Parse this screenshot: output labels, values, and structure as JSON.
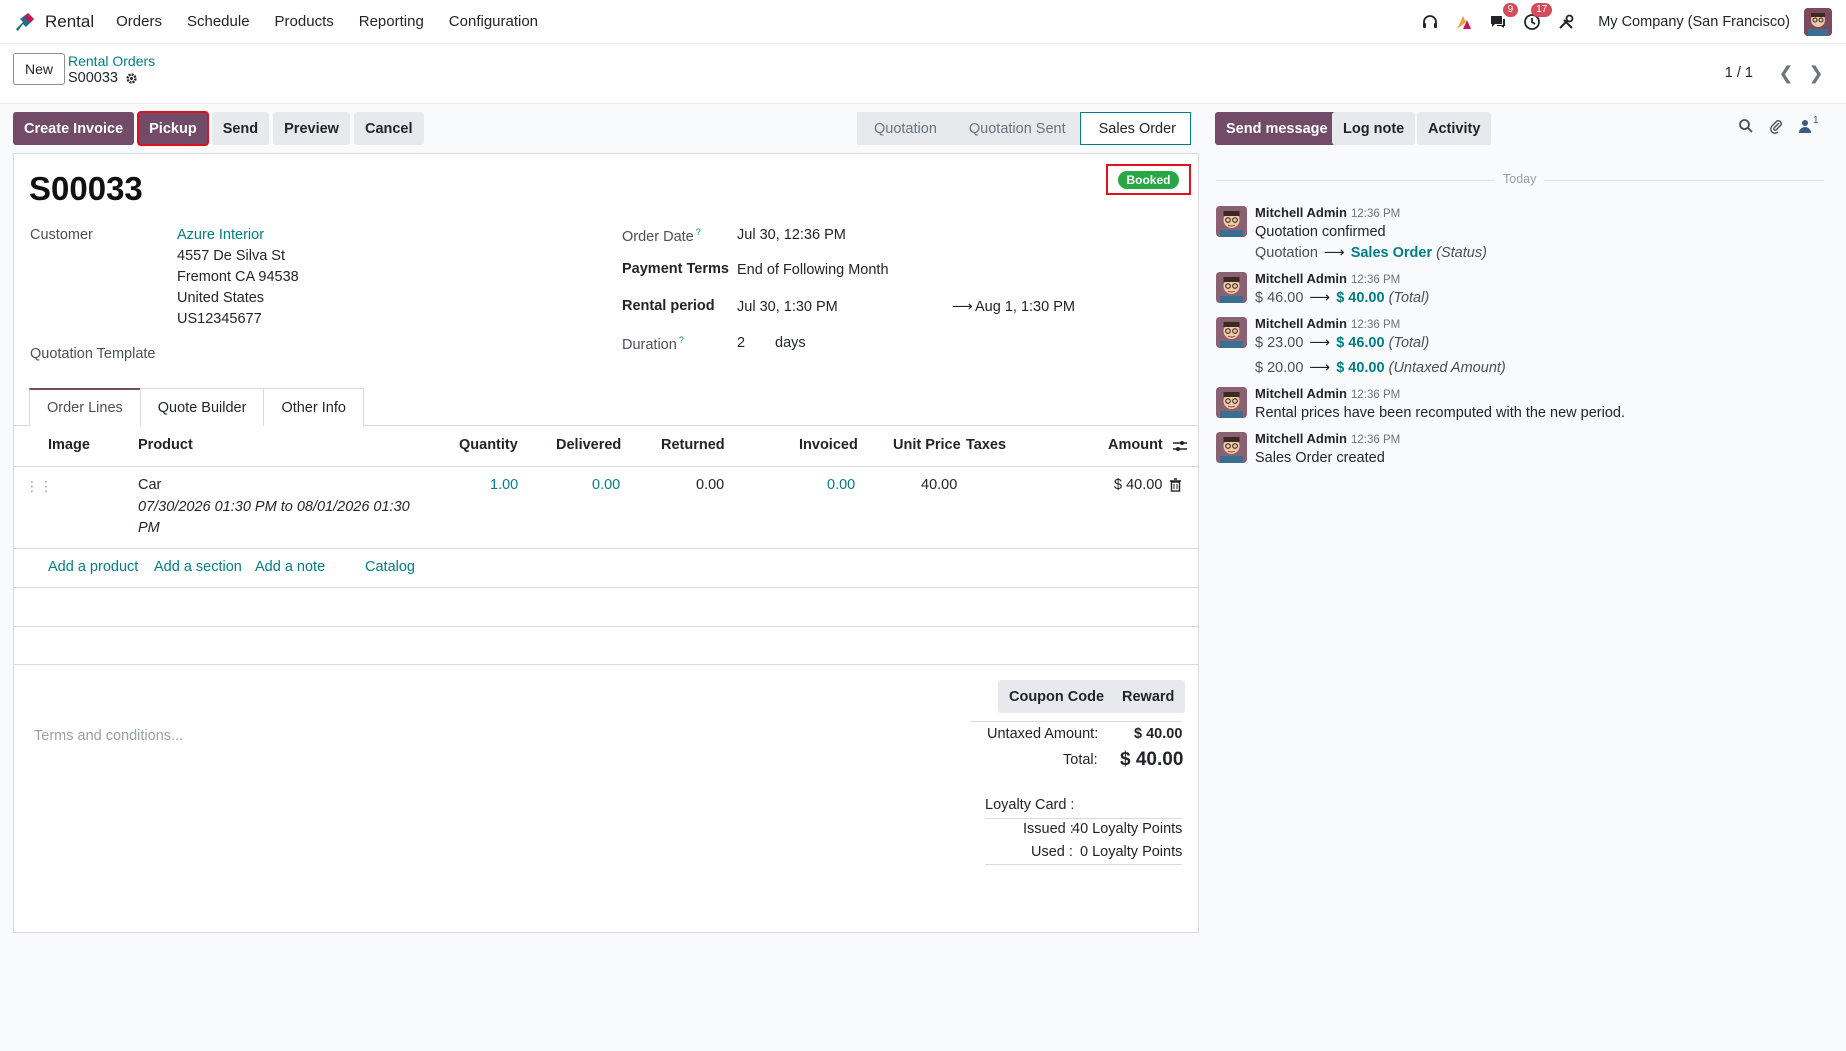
{
  "navbar": {
    "app_name": "Rental",
    "menu": [
      "Orders",
      "Schedule",
      "Products",
      "Reporting",
      "Configuration"
    ],
    "messages_count": "9",
    "activities_count": "17",
    "company": "My Company (San Francisco)"
  },
  "control": {
    "new_label": "New",
    "breadcrumb_parent": "Rental Orders",
    "breadcrumb_current": "S00033",
    "pager_value": "1 / 1"
  },
  "actions": {
    "create_invoice": "Create Invoice",
    "pickup": "Pickup",
    "send": "Send",
    "preview": "Preview",
    "cancel": "Cancel"
  },
  "stages": [
    "Quotation",
    "Quotation Sent",
    "Sales Order"
  ],
  "form": {
    "ribbon": "Booked",
    "title": "S00033",
    "customer_label": "Customer",
    "customer_name": "Azure Interior",
    "address": [
      "4557 De Silva St",
      "Fremont CA 94538",
      "United States",
      "US12345677"
    ],
    "quotation_template_label": "Quotation Template",
    "order_date_label": "Order Date",
    "order_date": "Jul 30, 12:36 PM",
    "payment_terms_label": "Payment Terms",
    "payment_terms": "End of Following Month",
    "rental_period_label": "Rental period",
    "rental_start": "Jul 30, 1:30 PM",
    "rental_end": "Aug 1, 1:30 PM",
    "duration_label": "Duration",
    "duration_value": "2",
    "duration_unit": "days",
    "help_mark": "?"
  },
  "tabs": [
    "Order Lines",
    "Quote Builder",
    "Other Info"
  ],
  "lines": {
    "headers": [
      "Image",
      "Product",
      "Quantity",
      "Delivered",
      "Returned",
      "Invoiced",
      "Unit Price",
      "Taxes",
      "Amount"
    ],
    "rows": [
      {
        "product": "Car",
        "description": "07/30/2026 01:30 PM to 08/01/2026 01:30",
        "description2": "PM",
        "quantity": "1.00",
        "delivered": "0.00",
        "returned": "0.00",
        "invoiced": "0.00",
        "unit_price": "40.00",
        "amount": "$ 40.00"
      }
    ],
    "add_links": [
      "Add a product",
      "Add a section",
      "Add a note",
      "Catalog"
    ]
  },
  "footer": {
    "coupon_label": "Coupon Code",
    "reward_label": "Reward",
    "terms_placeholder": "Terms and conditions...",
    "untaxed_label": "Untaxed Amount:",
    "untaxed_value": "$ 40.00",
    "total_label": "Total:",
    "total_value": "$ 40.00",
    "loyalty_label": "Loyalty Card :",
    "issued_label": "Issued :",
    "issued_value": "40 Loyalty Points",
    "used_label": "Used :",
    "used_value": "0 Loyalty Points"
  },
  "chatter": {
    "send_message": "Send message",
    "log_note": "Log note",
    "activity": "Activity",
    "followers_count": "1",
    "day_label": "Today",
    "messages": [
      {
        "author": "Mitchell Admin",
        "time": "12:36 PM",
        "text": "Quotation confirmed",
        "change_old": "Quotation",
        "change_new": "Sales Order",
        "change_field": "(Status)"
      },
      {
        "author": "Mitchell Admin",
        "time": "12:36 PM",
        "change_old": "$ 46.00",
        "change_new": "$ 40.00",
        "change_field": "(Total)"
      },
      {
        "author": "Mitchell Admin",
        "time": "12:36 PM",
        "change_old": "$ 23.00",
        "change_new": "$ 46.00",
        "change_field": "(Total)",
        "change2_old": "$ 20.00",
        "change2_new": "$ 40.00",
        "change2_field": "(Untaxed Amount)"
      },
      {
        "author": "Mitchell Admin",
        "time": "12:36 PM",
        "text": "Rental prices have been recomputed with the new period."
      },
      {
        "author": "Mitchell Admin",
        "time": "12:36 PM",
        "text": "Sales Order created"
      }
    ]
  },
  "colors": {
    "primary": "#714b67",
    "link": "#017e84",
    "success": "#28a745",
    "highlight": "#e0101e"
  }
}
